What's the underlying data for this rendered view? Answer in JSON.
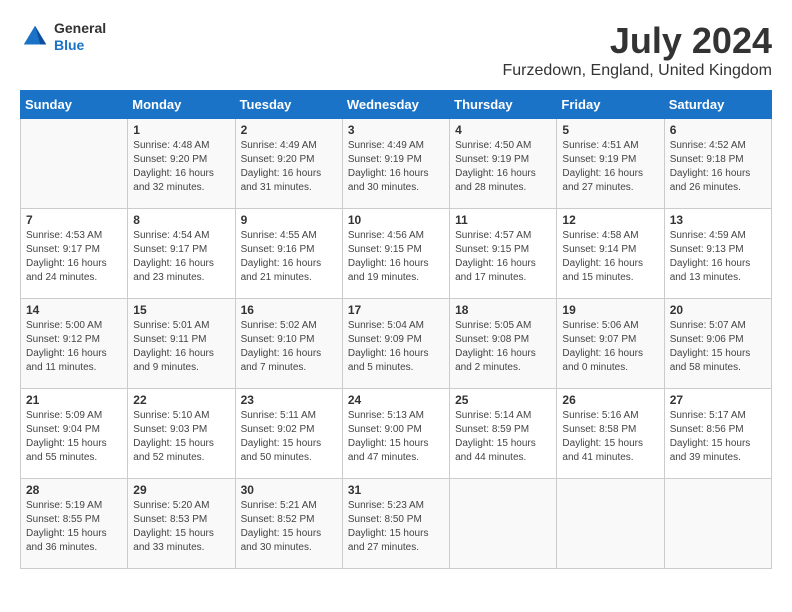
{
  "header": {
    "logo_general": "General",
    "logo_blue": "Blue",
    "month": "July 2024",
    "location": "Furzedown, England, United Kingdom"
  },
  "days_of_week": [
    "Sunday",
    "Monday",
    "Tuesday",
    "Wednesday",
    "Thursday",
    "Friday",
    "Saturday"
  ],
  "weeks": [
    [
      {
        "day": "",
        "sunrise": "",
        "sunset": "",
        "daylight": ""
      },
      {
        "day": "1",
        "sunrise": "Sunrise: 4:48 AM",
        "sunset": "Sunset: 9:20 PM",
        "daylight": "Daylight: 16 hours and 32 minutes."
      },
      {
        "day": "2",
        "sunrise": "Sunrise: 4:49 AM",
        "sunset": "Sunset: 9:20 PM",
        "daylight": "Daylight: 16 hours and 31 minutes."
      },
      {
        "day": "3",
        "sunrise": "Sunrise: 4:49 AM",
        "sunset": "Sunset: 9:19 PM",
        "daylight": "Daylight: 16 hours and 30 minutes."
      },
      {
        "day": "4",
        "sunrise": "Sunrise: 4:50 AM",
        "sunset": "Sunset: 9:19 PM",
        "daylight": "Daylight: 16 hours and 28 minutes."
      },
      {
        "day": "5",
        "sunrise": "Sunrise: 4:51 AM",
        "sunset": "Sunset: 9:19 PM",
        "daylight": "Daylight: 16 hours and 27 minutes."
      },
      {
        "day": "6",
        "sunrise": "Sunrise: 4:52 AM",
        "sunset": "Sunset: 9:18 PM",
        "daylight": "Daylight: 16 hours and 26 minutes."
      }
    ],
    [
      {
        "day": "7",
        "sunrise": "Sunrise: 4:53 AM",
        "sunset": "Sunset: 9:17 PM",
        "daylight": "Daylight: 16 hours and 24 minutes."
      },
      {
        "day": "8",
        "sunrise": "Sunrise: 4:54 AM",
        "sunset": "Sunset: 9:17 PM",
        "daylight": "Daylight: 16 hours and 23 minutes."
      },
      {
        "day": "9",
        "sunrise": "Sunrise: 4:55 AM",
        "sunset": "Sunset: 9:16 PM",
        "daylight": "Daylight: 16 hours and 21 minutes."
      },
      {
        "day": "10",
        "sunrise": "Sunrise: 4:56 AM",
        "sunset": "Sunset: 9:15 PM",
        "daylight": "Daylight: 16 hours and 19 minutes."
      },
      {
        "day": "11",
        "sunrise": "Sunrise: 4:57 AM",
        "sunset": "Sunset: 9:15 PM",
        "daylight": "Daylight: 16 hours and 17 minutes."
      },
      {
        "day": "12",
        "sunrise": "Sunrise: 4:58 AM",
        "sunset": "Sunset: 9:14 PM",
        "daylight": "Daylight: 16 hours and 15 minutes."
      },
      {
        "day": "13",
        "sunrise": "Sunrise: 4:59 AM",
        "sunset": "Sunset: 9:13 PM",
        "daylight": "Daylight: 16 hours and 13 minutes."
      }
    ],
    [
      {
        "day": "14",
        "sunrise": "Sunrise: 5:00 AM",
        "sunset": "Sunset: 9:12 PM",
        "daylight": "Daylight: 16 hours and 11 minutes."
      },
      {
        "day": "15",
        "sunrise": "Sunrise: 5:01 AM",
        "sunset": "Sunset: 9:11 PM",
        "daylight": "Daylight: 16 hours and 9 minutes."
      },
      {
        "day": "16",
        "sunrise": "Sunrise: 5:02 AM",
        "sunset": "Sunset: 9:10 PM",
        "daylight": "Daylight: 16 hours and 7 minutes."
      },
      {
        "day": "17",
        "sunrise": "Sunrise: 5:04 AM",
        "sunset": "Sunset: 9:09 PM",
        "daylight": "Daylight: 16 hours and 5 minutes."
      },
      {
        "day": "18",
        "sunrise": "Sunrise: 5:05 AM",
        "sunset": "Sunset: 9:08 PM",
        "daylight": "Daylight: 16 hours and 2 minutes."
      },
      {
        "day": "19",
        "sunrise": "Sunrise: 5:06 AM",
        "sunset": "Sunset: 9:07 PM",
        "daylight": "Daylight: 16 hours and 0 minutes."
      },
      {
        "day": "20",
        "sunrise": "Sunrise: 5:07 AM",
        "sunset": "Sunset: 9:06 PM",
        "daylight": "Daylight: 15 hours and 58 minutes."
      }
    ],
    [
      {
        "day": "21",
        "sunrise": "Sunrise: 5:09 AM",
        "sunset": "Sunset: 9:04 PM",
        "daylight": "Daylight: 15 hours and 55 minutes."
      },
      {
        "day": "22",
        "sunrise": "Sunrise: 5:10 AM",
        "sunset": "Sunset: 9:03 PM",
        "daylight": "Daylight: 15 hours and 52 minutes."
      },
      {
        "day": "23",
        "sunrise": "Sunrise: 5:11 AM",
        "sunset": "Sunset: 9:02 PM",
        "daylight": "Daylight: 15 hours and 50 minutes."
      },
      {
        "day": "24",
        "sunrise": "Sunrise: 5:13 AM",
        "sunset": "Sunset: 9:00 PM",
        "daylight": "Daylight: 15 hours and 47 minutes."
      },
      {
        "day": "25",
        "sunrise": "Sunrise: 5:14 AM",
        "sunset": "Sunset: 8:59 PM",
        "daylight": "Daylight: 15 hours and 44 minutes."
      },
      {
        "day": "26",
        "sunrise": "Sunrise: 5:16 AM",
        "sunset": "Sunset: 8:58 PM",
        "daylight": "Daylight: 15 hours and 41 minutes."
      },
      {
        "day": "27",
        "sunrise": "Sunrise: 5:17 AM",
        "sunset": "Sunset: 8:56 PM",
        "daylight": "Daylight: 15 hours and 39 minutes."
      }
    ],
    [
      {
        "day": "28",
        "sunrise": "Sunrise: 5:19 AM",
        "sunset": "Sunset: 8:55 PM",
        "daylight": "Daylight: 15 hours and 36 minutes."
      },
      {
        "day": "29",
        "sunrise": "Sunrise: 5:20 AM",
        "sunset": "Sunset: 8:53 PM",
        "daylight": "Daylight: 15 hours and 33 minutes."
      },
      {
        "day": "30",
        "sunrise": "Sunrise: 5:21 AM",
        "sunset": "Sunset: 8:52 PM",
        "daylight": "Daylight: 15 hours and 30 minutes."
      },
      {
        "day": "31",
        "sunrise": "Sunrise: 5:23 AM",
        "sunset": "Sunset: 8:50 PM",
        "daylight": "Daylight: 15 hours and 27 minutes."
      },
      {
        "day": "",
        "sunrise": "",
        "sunset": "",
        "daylight": ""
      },
      {
        "day": "",
        "sunrise": "",
        "sunset": "",
        "daylight": ""
      },
      {
        "day": "",
        "sunrise": "",
        "sunset": "",
        "daylight": ""
      }
    ]
  ]
}
